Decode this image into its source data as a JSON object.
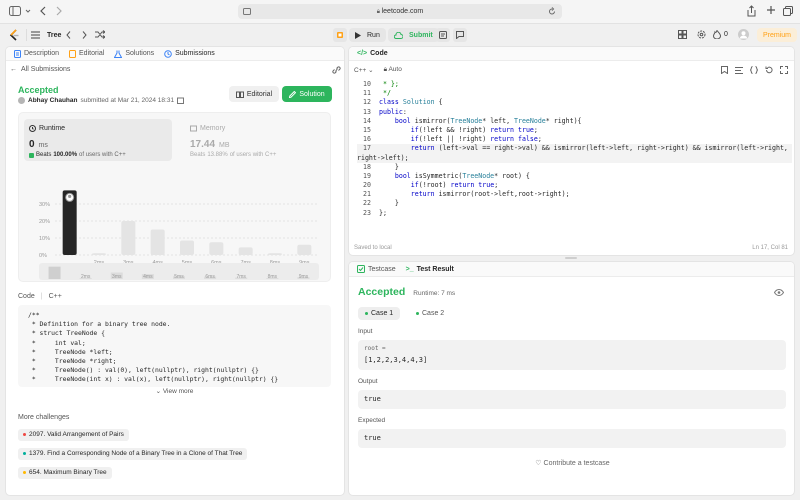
{
  "browser": {
    "url": "leetcode.com"
  },
  "appbar": {
    "title": "Tree",
    "run_label": "Run",
    "submit_label": "Submit",
    "fire_count": "0",
    "premium_label": "Premium"
  },
  "left": {
    "tabs": [
      {
        "label": "Description"
      },
      {
        "label": "Editorial"
      },
      {
        "label": "Solutions"
      },
      {
        "label": "Submissions"
      }
    ],
    "all_submissions": "All Submissions",
    "status": "Accepted",
    "author": "Abhay Chauhan",
    "submitted_at": "submitted at Mar 21, 2024 18:31",
    "editorial_btn": "Editorial",
    "solution_btn": "Solution",
    "runtime": {
      "label": "Runtime",
      "value": "0",
      "unit": "ms",
      "beats_prefix": "Beats",
      "beats_pct": "100.00%",
      "beats_suffix": "of users with C++"
    },
    "memory": {
      "label": "Memory",
      "value": "17.44",
      "unit": "MB",
      "beats_prefix": "Beats",
      "beats_pct": "13.88%",
      "beats_suffix": "of users with C++"
    },
    "code_label": "Code",
    "lang": "C++",
    "code_lines": [
      "/**",
      " * Definition for a binary tree node.",
      " * struct TreeNode {",
      " *     int val;",
      " *     TreeNode *left;",
      " *     TreeNode *right;",
      " *     TreeNode() : val(0), left(nullptr), right(nullptr) {}",
      " *     TreeNode(int x) : val(x), left(nullptr), right(nullptr) {}"
    ],
    "view_more": "View more",
    "more_challenges": "More challenges",
    "challenges": [
      {
        "label": "2097. Valid Arrangement of Pairs",
        "color": "#ef4743"
      },
      {
        "label": "1379. Find a Corresponding Node of a Binary Tree in a Clone of That Tree",
        "color": "#00af9b"
      },
      {
        "label": "654. Maximum Binary Tree",
        "color": "#ffb800"
      }
    ]
  },
  "chart_data": {
    "type": "bar",
    "categories": [
      "",
      "2ms",
      "3ms",
      "4ms",
      "5ms",
      "6ms",
      "7ms",
      "8ms",
      "9ms"
    ],
    "values": [
      38,
      1,
      20,
      15,
      8.5,
      7.5,
      4.5,
      1,
      6
    ],
    "highlight_index": 0,
    "y_ticks": [
      "30%",
      "20%",
      "10%",
      "0%"
    ],
    "ylim": [
      0,
      40
    ],
    "overview_labels": [
      "2ms",
      "3ms",
      "4ms",
      "5ms",
      "6ms",
      "7ms",
      "8ms",
      "9ms"
    ]
  },
  "editor": {
    "title": "Code",
    "lang": "C++",
    "auto_label": "Auto",
    "saved": "Saved to local",
    "cursor": "Ln 17, Col 81",
    "lines": [
      {
        "n": "10",
        "t": " * };"
      },
      {
        "n": "11",
        "t": " */"
      },
      {
        "n": "12",
        "t": "class Solution {"
      },
      {
        "n": "13",
        "t": "public:"
      },
      {
        "n": "14",
        "t": "    bool ismirror(TreeNode* left, TreeNode* right){"
      },
      {
        "n": "15",
        "t": "        if(!left && !right) return true;"
      },
      {
        "n": "16",
        "t": "        if(!left || !right) return false;"
      },
      {
        "n": "17",
        "t": "        return (left->val == right->val) && ismirror(left->left, right->right) && ismirror(left->right,"
      },
      {
        "n": "",
        "t": "right->left);"
      },
      {
        "n": "18",
        "t": "    }"
      },
      {
        "n": "19",
        "t": "    bool isSymmetric(TreeNode* root) {"
      },
      {
        "n": "20",
        "t": "        if(!root) return true;"
      },
      {
        "n": "21",
        "t": "        return ismirror(root->left,root->right);"
      },
      {
        "n": "22",
        "t": "    }"
      },
      {
        "n": "23",
        "t": "};"
      }
    ]
  },
  "result": {
    "tab_testcase": "Testcase",
    "tab_result": "Test Result",
    "status": "Accepted",
    "runtime": "Runtime: 7 ms",
    "case1": "Case 1",
    "case2": "Case 2",
    "input_label": "Input",
    "input_var": "root =",
    "input_val": "[1,2,2,3,4,4,3]",
    "output_label": "Output",
    "output_val": "true",
    "expected_label": "Expected",
    "expected_val": "true",
    "contribute": "Contribute a testcase"
  },
  "colors": {
    "accent_green": "#2db55d",
    "orange": "#ffa116",
    "blue": "#007aff"
  }
}
